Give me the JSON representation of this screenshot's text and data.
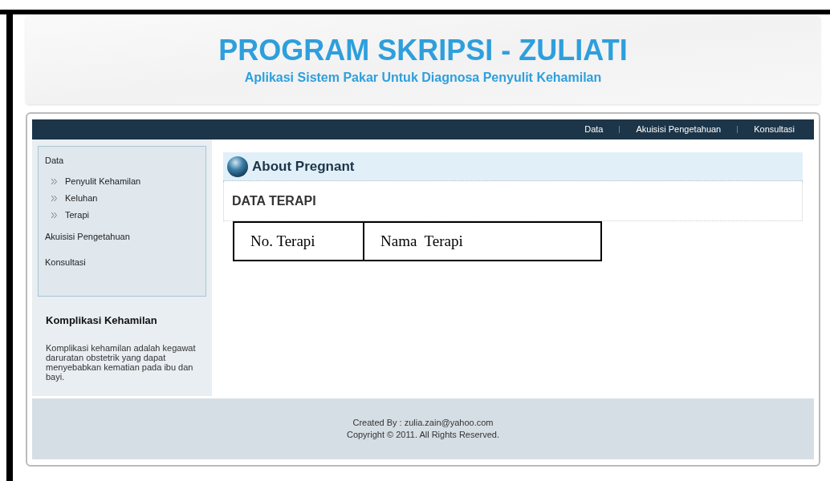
{
  "header": {
    "title": "PROGRAM SKRIPSI - ZULIATI",
    "subtitle": "Aplikasi Sistem Pakar Untuk Diagnosa Penyulit Kehamilan"
  },
  "nav": [
    "Data",
    "Akuisisi Pengetahuan",
    "Konsultasi"
  ],
  "sidebar": {
    "items": [
      {
        "label": "Data",
        "children": [
          {
            "label": "Penyulit Kehamilan"
          },
          {
            "label": "Keluhan"
          },
          {
            "label": "Terapi"
          }
        ]
      },
      {
        "label": "Akuisisi Pengetahuan"
      },
      {
        "label": "Konsultasi"
      }
    ],
    "info_title": "Komplikasi Kehamilan",
    "info_text": "Komplikasi kehamilan adalah kegawat daruratan obstetrik yang dapat menyebabkan kematian pada ibu dan bayi."
  },
  "content": {
    "title": "About Pregnant",
    "heading": "DATA TERAPI",
    "table": {
      "columns": [
        "No. Terapi",
        "Nama  Terapi"
      ]
    }
  },
  "footer": [
    "Created By : zulia.zain@yahoo.com",
    "Copyright © 2011. All Rights Reserved."
  ]
}
